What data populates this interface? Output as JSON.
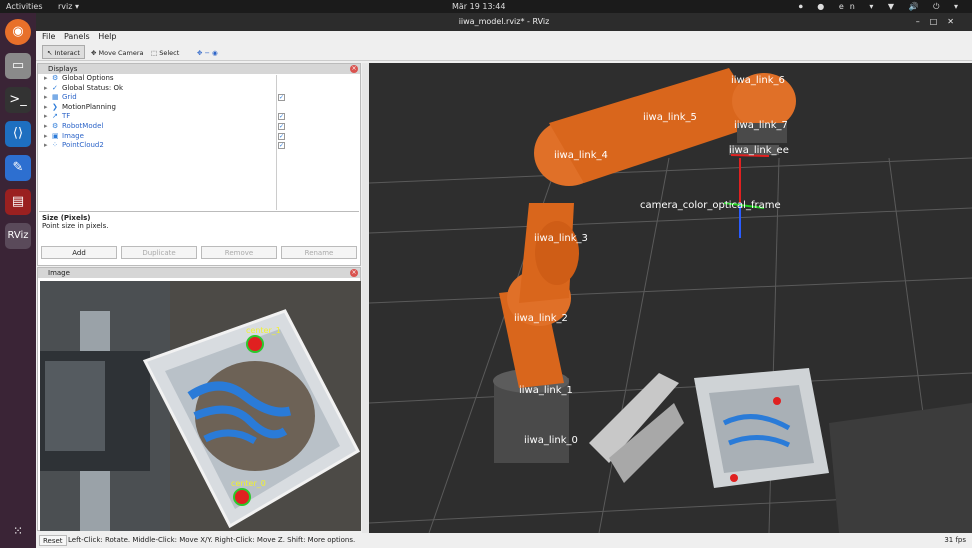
{
  "topbar": {
    "activities": "Activities",
    "app_name": "rviz ▾",
    "clock": "Mär 19  13:44",
    "tray": "⏺ ● en ▾ ▼ 🔊 ⏻ ▾",
    "lang": "en"
  },
  "window": {
    "title": "iiwa_model.rviz* - RViz"
  },
  "menu": [
    "File",
    "Panels",
    "Help"
  ],
  "toolbar": {
    "interact": "Interact",
    "move_camera": "Move Camera",
    "select": "Select",
    "extra_icons": "✥  −  ◉"
  },
  "displays": {
    "title": "Displays",
    "items": [
      {
        "label": "Global Options",
        "icon": "⚙",
        "checked": false,
        "style": "plain"
      },
      {
        "label": "Global Status: Ok",
        "icon": "✓",
        "checked": false,
        "style": "plain"
      },
      {
        "label": "Grid",
        "icon": "▦",
        "checked": true,
        "style": "blue"
      },
      {
        "label": "MotionPlanning",
        "icon": "❯",
        "checked": false,
        "style": "plain"
      },
      {
        "label": "TF",
        "icon": "↗",
        "checked": true,
        "style": "blue"
      },
      {
        "label": "RobotModel",
        "icon": "⚙",
        "checked": true,
        "style": "blue"
      },
      {
        "label": "Image",
        "icon": "▣",
        "checked": true,
        "style": "blue"
      },
      {
        "label": "PointCloud2",
        "icon": "⁘",
        "checked": true,
        "style": "blue"
      }
    ],
    "desc_title": "Size (Pixels)",
    "desc_text": "Point size in pixels.",
    "buttons": {
      "add": "Add",
      "duplicate": "Duplicate",
      "remove": "Remove",
      "rename": "Rename"
    }
  },
  "image_panel": {
    "title": "Image",
    "labels": {
      "center1": "center_1",
      "center0": "center_0"
    }
  },
  "viewport": {
    "links": {
      "l6": "iiwa_link_6",
      "l5": "iiwa_link_5",
      "l7": "iiwa_link_7",
      "l4": "iiwa_link_4",
      "lee": "iiwa_link_ee",
      "cam": "camera_color_optical_frame",
      "l3": "iiwa_link_3",
      "l2": "iiwa_link_2",
      "l1": "iiwa_link_1",
      "l0": "iiwa_link_0"
    }
  },
  "status": {
    "reset": "Reset",
    "hint": "Left-Click: Rotate. Middle-Click: Move X/Y. Right-Click: Move Z. Shift: More options.",
    "fps": "31 fps"
  },
  "colors": {
    "robot_orange": "#d9661c",
    "dock_bg": "#3a2436",
    "marker_red": "#e02020",
    "marker_yellow": "#f2f230",
    "box_blue": "#2a7bd8"
  }
}
